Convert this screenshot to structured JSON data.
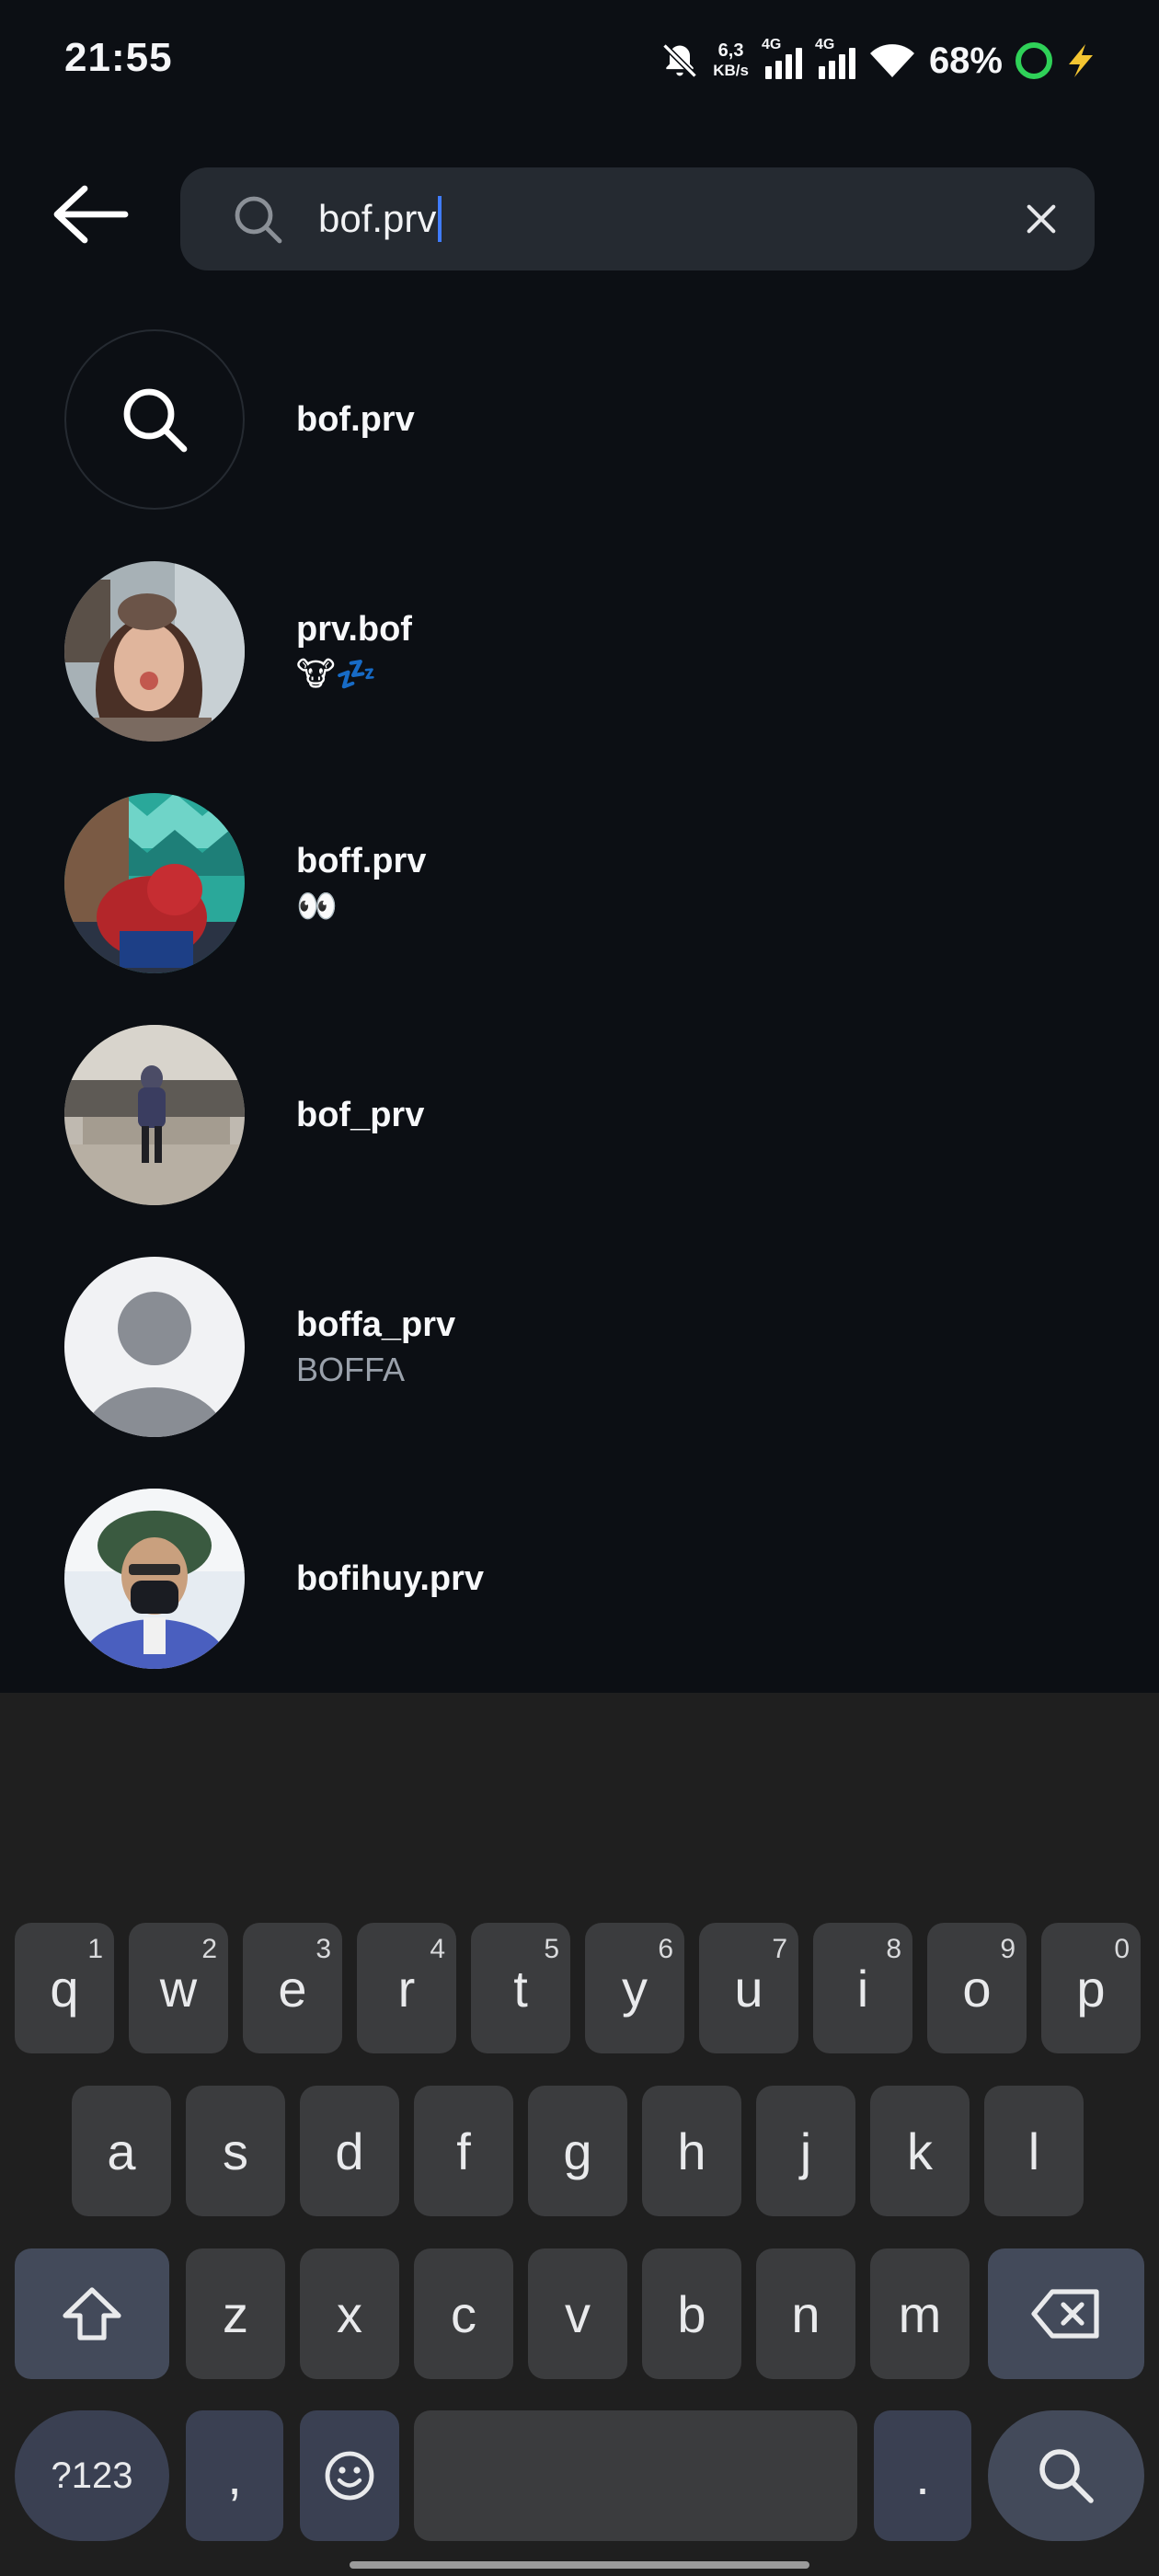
{
  "status_bar": {
    "time": "21:55",
    "net_speed_value": "6,3",
    "net_speed_unit": "KB/s",
    "sim1_tag": "4G",
    "sim2_tag": "4G",
    "battery": "68%",
    "icons": [
      "bell-off-icon",
      "signal-icon",
      "wifi-icon",
      "battery-ring-icon",
      "charging-bolt-icon"
    ]
  },
  "search": {
    "query": "bof.prv",
    "icons": [
      "back-arrow-icon",
      "search-icon",
      "close-icon"
    ]
  },
  "results": [
    {
      "username": "bof.prv",
      "subtitle": "",
      "type": "search-suggestion"
    },
    {
      "username": "prv.bof",
      "subtitle": "🐮💤",
      "type": "profile"
    },
    {
      "username": "boff.prv",
      "subtitle": "👀",
      "type": "profile"
    },
    {
      "username": "bof_prv",
      "subtitle": "",
      "type": "profile"
    },
    {
      "username": "boffa_prv",
      "subtitle": "BOFFA",
      "type": "profile"
    },
    {
      "username": "bofihuy.prv",
      "subtitle": "",
      "type": "profile"
    }
  ],
  "keyboard": {
    "row1": [
      {
        "k": "q",
        "h": "1"
      },
      {
        "k": "w",
        "h": "2"
      },
      {
        "k": "e",
        "h": "3"
      },
      {
        "k": "r",
        "h": "4"
      },
      {
        "k": "t",
        "h": "5"
      },
      {
        "k": "y",
        "h": "6"
      },
      {
        "k": "u",
        "h": "7"
      },
      {
        "k": "i",
        "h": "8"
      },
      {
        "k": "o",
        "h": "9"
      },
      {
        "k": "p",
        "h": "0"
      }
    ],
    "row2": [
      "a",
      "s",
      "d",
      "f",
      "g",
      "h",
      "j",
      "k",
      "l"
    ],
    "row3": [
      "z",
      "x",
      "c",
      "v",
      "b",
      "n",
      "m"
    ],
    "symbols_label": "?123",
    "comma": ",",
    "period": "."
  }
}
